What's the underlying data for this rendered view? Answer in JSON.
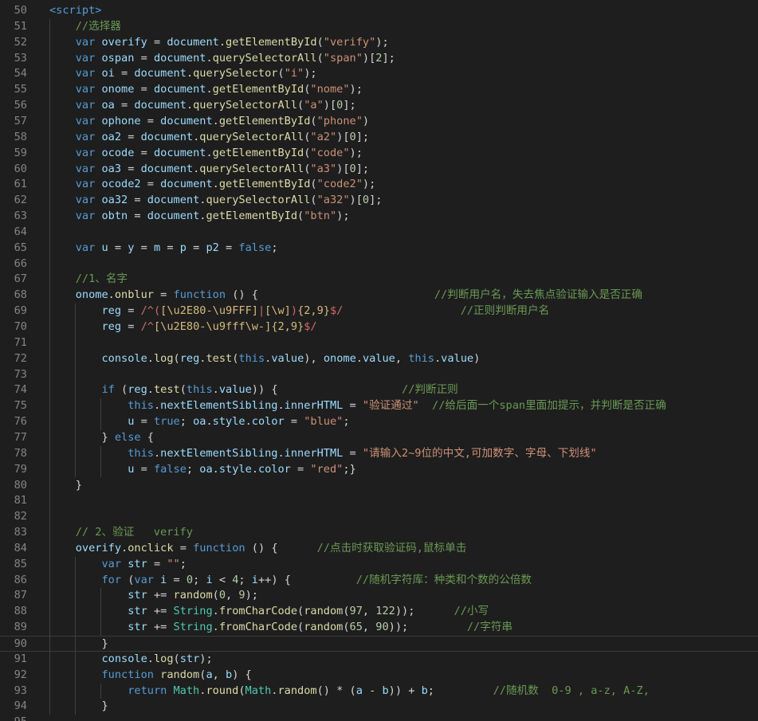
{
  "editor": {
    "language": "javascript",
    "first_line": 50,
    "current_line": 90,
    "lines": [
      [
        [
          "tg",
          "<script>"
        ]
      ],
      [
        [
          "c",
          "    //选择器"
        ]
      ],
      [
        [
          "k",
          "    var "
        ],
        [
          "v",
          "overify"
        ],
        [
          "p",
          " = "
        ],
        [
          "v",
          "document"
        ],
        [
          "p",
          "."
        ],
        [
          "f",
          "getElementById"
        ],
        [
          "p",
          "("
        ],
        [
          "s",
          "\"verify\""
        ],
        [
          "p",
          ");"
        ]
      ],
      [
        [
          "k",
          "    var "
        ],
        [
          "v",
          "ospan"
        ],
        [
          "p",
          " = "
        ],
        [
          "v",
          "document"
        ],
        [
          "p",
          "."
        ],
        [
          "f",
          "querySelectorAll"
        ],
        [
          "p",
          "("
        ],
        [
          "s",
          "\"span\""
        ],
        [
          "p",
          ")["
        ],
        [
          "n",
          "2"
        ],
        [
          "p",
          "];"
        ]
      ],
      [
        [
          "k",
          "    var "
        ],
        [
          "v",
          "oi"
        ],
        [
          "p",
          " = "
        ],
        [
          "v",
          "document"
        ],
        [
          "p",
          "."
        ],
        [
          "f",
          "querySelector"
        ],
        [
          "p",
          "("
        ],
        [
          "s",
          "\"i\""
        ],
        [
          "p",
          ");"
        ]
      ],
      [
        [
          "k",
          "    var "
        ],
        [
          "v",
          "onome"
        ],
        [
          "p",
          " = "
        ],
        [
          "v",
          "document"
        ],
        [
          "p",
          "."
        ],
        [
          "f",
          "getElementById"
        ],
        [
          "p",
          "("
        ],
        [
          "s",
          "\"nome\""
        ],
        [
          "p",
          ");"
        ]
      ],
      [
        [
          "k",
          "    var "
        ],
        [
          "v",
          "oa"
        ],
        [
          "p",
          " = "
        ],
        [
          "v",
          "document"
        ],
        [
          "p",
          "."
        ],
        [
          "f",
          "querySelectorAll"
        ],
        [
          "p",
          "("
        ],
        [
          "s",
          "\"a\""
        ],
        [
          "p",
          ")["
        ],
        [
          "n",
          "0"
        ],
        [
          "p",
          "];"
        ]
      ],
      [
        [
          "k",
          "    var "
        ],
        [
          "v",
          "ophone"
        ],
        [
          "p",
          " = "
        ],
        [
          "v",
          "document"
        ],
        [
          "p",
          "."
        ],
        [
          "f",
          "getElementById"
        ],
        [
          "p",
          "("
        ],
        [
          "s",
          "\"phone\""
        ],
        [
          "p",
          ")"
        ]
      ],
      [
        [
          "k",
          "    var "
        ],
        [
          "v",
          "oa2"
        ],
        [
          "p",
          " = "
        ],
        [
          "v",
          "document"
        ],
        [
          "p",
          "."
        ],
        [
          "f",
          "querySelectorAll"
        ],
        [
          "p",
          "("
        ],
        [
          "s",
          "\"a2\""
        ],
        [
          "p",
          ")["
        ],
        [
          "n",
          "0"
        ],
        [
          "p",
          "];"
        ]
      ],
      [
        [
          "k",
          "    var "
        ],
        [
          "v",
          "ocode"
        ],
        [
          "p",
          " = "
        ],
        [
          "v",
          "document"
        ],
        [
          "p",
          "."
        ],
        [
          "f",
          "getElementById"
        ],
        [
          "p",
          "("
        ],
        [
          "s",
          "\"code\""
        ],
        [
          "p",
          ");"
        ]
      ],
      [
        [
          "k",
          "    var "
        ],
        [
          "v",
          "oa3"
        ],
        [
          "p",
          " = "
        ],
        [
          "v",
          "document"
        ],
        [
          "p",
          "."
        ],
        [
          "f",
          "querySelectorAll"
        ],
        [
          "p",
          "("
        ],
        [
          "s",
          "\"a3\""
        ],
        [
          "p",
          ")["
        ],
        [
          "n",
          "0"
        ],
        [
          "p",
          "];"
        ]
      ],
      [
        [
          "k",
          "    var "
        ],
        [
          "v",
          "ocode2"
        ],
        [
          "p",
          " = "
        ],
        [
          "v",
          "document"
        ],
        [
          "p",
          "."
        ],
        [
          "f",
          "getElementById"
        ],
        [
          "p",
          "("
        ],
        [
          "s",
          "\"code2\""
        ],
        [
          "p",
          ");"
        ]
      ],
      [
        [
          "k",
          "    var "
        ],
        [
          "v",
          "oa32"
        ],
        [
          "p",
          " = "
        ],
        [
          "v",
          "document"
        ],
        [
          "p",
          "."
        ],
        [
          "f",
          "querySelectorAll"
        ],
        [
          "p",
          "("
        ],
        [
          "s",
          "\"a32\""
        ],
        [
          "p",
          ")["
        ],
        [
          "n",
          "0"
        ],
        [
          "p",
          "];"
        ]
      ],
      [
        [
          "k",
          "    var "
        ],
        [
          "v",
          "obtn"
        ],
        [
          "p",
          " = "
        ],
        [
          "v",
          "document"
        ],
        [
          "p",
          "."
        ],
        [
          "f",
          "getElementById"
        ],
        [
          "p",
          "("
        ],
        [
          "s",
          "\"btn\""
        ],
        [
          "p",
          ");"
        ]
      ],
      [],
      [
        [
          "k",
          "    var "
        ],
        [
          "v",
          "u"
        ],
        [
          "p",
          " = "
        ],
        [
          "v",
          "y"
        ],
        [
          "p",
          " = "
        ],
        [
          "v",
          "m"
        ],
        [
          "p",
          " = "
        ],
        [
          "v",
          "p"
        ],
        [
          "p",
          " = "
        ],
        [
          "v",
          "p2"
        ],
        [
          "p",
          " = "
        ],
        [
          "k",
          "false"
        ],
        [
          "p",
          ";"
        ]
      ],
      [],
      [
        [
          "c",
          "    //1、名字"
        ]
      ],
      [
        [
          "p",
          "    "
        ],
        [
          "v",
          "onome"
        ],
        [
          "p",
          "."
        ],
        [
          "f",
          "onblur"
        ],
        [
          "p",
          " = "
        ],
        [
          "k",
          "function"
        ],
        [
          "p",
          " () {                           "
        ],
        [
          "c",
          "//判断用户名，失去焦点验证输入是否正确"
        ]
      ],
      [
        [
          "p",
          "        "
        ],
        [
          "v",
          "reg"
        ],
        [
          "p",
          " = "
        ],
        [
          "r",
          "/^("
        ],
        [
          "re",
          "[\\u2E80-\\u9FFF]"
        ],
        [
          "r",
          "|"
        ],
        [
          "re",
          "[\\w]"
        ],
        [
          "r",
          ")"
        ],
        [
          "re",
          "{2,9}"
        ],
        [
          "r",
          "$/"
        ],
        [
          "p",
          "                  "
        ],
        [
          "c",
          "//正则判断用户名"
        ]
      ],
      [
        [
          "p",
          "        "
        ],
        [
          "v",
          "reg"
        ],
        [
          "p",
          " = "
        ],
        [
          "r",
          "/^"
        ],
        [
          "re",
          "[\\u2E80-\\u9fff\\w-]"
        ],
        [
          "re",
          "{2,9}"
        ],
        [
          "r",
          "$/"
        ]
      ],
      [],
      [
        [
          "p",
          "        "
        ],
        [
          "v",
          "console"
        ],
        [
          "p",
          "."
        ],
        [
          "f",
          "log"
        ],
        [
          "p",
          "("
        ],
        [
          "v",
          "reg"
        ],
        [
          "p",
          "."
        ],
        [
          "f",
          "test"
        ],
        [
          "p",
          "("
        ],
        [
          "k",
          "this"
        ],
        [
          "p",
          "."
        ],
        [
          "v",
          "value"
        ],
        [
          "p",
          "), "
        ],
        [
          "v",
          "onome"
        ],
        [
          "p",
          "."
        ],
        [
          "v",
          "value"
        ],
        [
          "p",
          ", "
        ],
        [
          "k",
          "this"
        ],
        [
          "p",
          "."
        ],
        [
          "v",
          "value"
        ],
        [
          "p",
          ")"
        ]
      ],
      [],
      [
        [
          "k",
          "        if"
        ],
        [
          "p",
          " ("
        ],
        [
          "v",
          "reg"
        ],
        [
          "p",
          "."
        ],
        [
          "f",
          "test"
        ],
        [
          "p",
          "("
        ],
        [
          "k",
          "this"
        ],
        [
          "p",
          "."
        ],
        [
          "v",
          "value"
        ],
        [
          "p",
          ")) {                   "
        ],
        [
          "c",
          "//判断正则"
        ]
      ],
      [
        [
          "k",
          "            this"
        ],
        [
          "p",
          "."
        ],
        [
          "v",
          "nextElementSibling"
        ],
        [
          "p",
          "."
        ],
        [
          "v",
          "innerHTML"
        ],
        [
          "p",
          " = "
        ],
        [
          "s",
          "\"验证通过\""
        ],
        [
          "p",
          "  "
        ],
        [
          "c",
          "//给后面一个span里面加提示，并判断是否正确"
        ]
      ],
      [
        [
          "p",
          "            "
        ],
        [
          "v",
          "u"
        ],
        [
          "p",
          " = "
        ],
        [
          "k",
          "true"
        ],
        [
          "p",
          "; "
        ],
        [
          "v",
          "oa"
        ],
        [
          "p",
          "."
        ],
        [
          "v",
          "style"
        ],
        [
          "p",
          "."
        ],
        [
          "v",
          "color"
        ],
        [
          "p",
          " = "
        ],
        [
          "s",
          "\"blue\""
        ],
        [
          "p",
          ";"
        ]
      ],
      [
        [
          "p",
          "        } "
        ],
        [
          "k",
          "else"
        ],
        [
          "p",
          " {"
        ]
      ],
      [
        [
          "k",
          "            this"
        ],
        [
          "p",
          "."
        ],
        [
          "v",
          "nextElementSibling"
        ],
        [
          "p",
          "."
        ],
        [
          "v",
          "innerHTML"
        ],
        [
          "p",
          " = "
        ],
        [
          "s",
          "\"请输入2~9位的中文,可加数字、字母、下划线\""
        ]
      ],
      [
        [
          "p",
          "            "
        ],
        [
          "v",
          "u"
        ],
        [
          "p",
          " = "
        ],
        [
          "k",
          "false"
        ],
        [
          "p",
          "; "
        ],
        [
          "v",
          "oa"
        ],
        [
          "p",
          "."
        ],
        [
          "v",
          "style"
        ],
        [
          "p",
          "."
        ],
        [
          "v",
          "color"
        ],
        [
          "p",
          " = "
        ],
        [
          "s",
          "\"red\""
        ],
        [
          "p",
          ";}"
        ]
      ],
      [
        [
          "p",
          "    }"
        ]
      ],
      [],
      [],
      [
        [
          "c",
          "    // 2、验证   verify"
        ]
      ],
      [
        [
          "p",
          "    "
        ],
        [
          "v",
          "overify"
        ],
        [
          "p",
          "."
        ],
        [
          "f",
          "onclick"
        ],
        [
          "p",
          " = "
        ],
        [
          "k",
          "function"
        ],
        [
          "p",
          " () {      "
        ],
        [
          "c",
          "//点击时获取验证码,鼠标单击"
        ]
      ],
      [
        [
          "k",
          "        var "
        ],
        [
          "v",
          "str"
        ],
        [
          "p",
          " = "
        ],
        [
          "s",
          "\"\""
        ],
        [
          "p",
          ";"
        ]
      ],
      [
        [
          "k",
          "        for"
        ],
        [
          "p",
          " ("
        ],
        [
          "k",
          "var "
        ],
        [
          "v",
          "i"
        ],
        [
          "p",
          " = "
        ],
        [
          "n",
          "0"
        ],
        [
          "p",
          "; "
        ],
        [
          "v",
          "i"
        ],
        [
          "p",
          " < "
        ],
        [
          "n",
          "4"
        ],
        [
          "p",
          "; "
        ],
        [
          "v",
          "i"
        ],
        [
          "p",
          "++) "
        ],
        [
          "p",
          "{"
        ],
        [
          "p",
          "          "
        ],
        [
          "c",
          "//随机字符库：种类和个数的公倍数"
        ]
      ],
      [
        [
          "p",
          "            "
        ],
        [
          "v",
          "str"
        ],
        [
          "p",
          " += "
        ],
        [
          "f",
          "random"
        ],
        [
          "p",
          "("
        ],
        [
          "n",
          "0"
        ],
        [
          "p",
          ", "
        ],
        [
          "n",
          "9"
        ],
        [
          "p",
          ");"
        ]
      ],
      [
        [
          "p",
          "            "
        ],
        [
          "v",
          "str"
        ],
        [
          "p",
          " += "
        ],
        [
          "t",
          "String"
        ],
        [
          "p",
          "."
        ],
        [
          "f",
          "fromCharCode"
        ],
        [
          "p",
          "("
        ],
        [
          "f",
          "random"
        ],
        [
          "p",
          "("
        ],
        [
          "n",
          "97"
        ],
        [
          "p",
          ", "
        ],
        [
          "n",
          "122"
        ],
        [
          "p",
          "));      "
        ],
        [
          "c",
          "//小写"
        ]
      ],
      [
        [
          "p",
          "            "
        ],
        [
          "v",
          "str"
        ],
        [
          "p",
          " += "
        ],
        [
          "t",
          "String"
        ],
        [
          "p",
          "."
        ],
        [
          "f",
          "fromCharCode"
        ],
        [
          "p",
          "("
        ],
        [
          "f",
          "random"
        ],
        [
          "p",
          "("
        ],
        [
          "n",
          "65"
        ],
        [
          "p",
          ", "
        ],
        [
          "n",
          "90"
        ],
        [
          "p",
          "));         "
        ],
        [
          "c",
          "//字符串"
        ]
      ],
      [
        [
          "p",
          "        "
        ],
        [
          "p",
          "}"
        ]
      ],
      [
        [
          "p",
          "        "
        ],
        [
          "v",
          "console"
        ],
        [
          "p",
          "."
        ],
        [
          "f",
          "log"
        ],
        [
          "p",
          "("
        ],
        [
          "v",
          "str"
        ],
        [
          "p",
          ");"
        ]
      ],
      [
        [
          "k",
          "        function "
        ],
        [
          "f",
          "random"
        ],
        [
          "p",
          "("
        ],
        [
          "v",
          "a"
        ],
        [
          "p",
          ", "
        ],
        [
          "v",
          "b"
        ],
        [
          "p",
          ") {"
        ]
      ],
      [
        [
          "k",
          "            return "
        ],
        [
          "t",
          "Math"
        ],
        [
          "p",
          "."
        ],
        [
          "f",
          "round"
        ],
        [
          "p",
          "("
        ],
        [
          "t",
          "Math"
        ],
        [
          "p",
          "."
        ],
        [
          "f",
          "random"
        ],
        [
          "p",
          "() * ("
        ],
        [
          "v",
          "a"
        ],
        [
          "p",
          " - "
        ],
        [
          "v",
          "b"
        ],
        [
          "p",
          ")) + "
        ],
        [
          "v",
          "b"
        ],
        [
          "p",
          ";         "
        ],
        [
          "c",
          "//随机数  0-9 , a-z, A-Z,"
        ]
      ],
      [
        [
          "p",
          "        }"
        ]
      ],
      []
    ]
  }
}
